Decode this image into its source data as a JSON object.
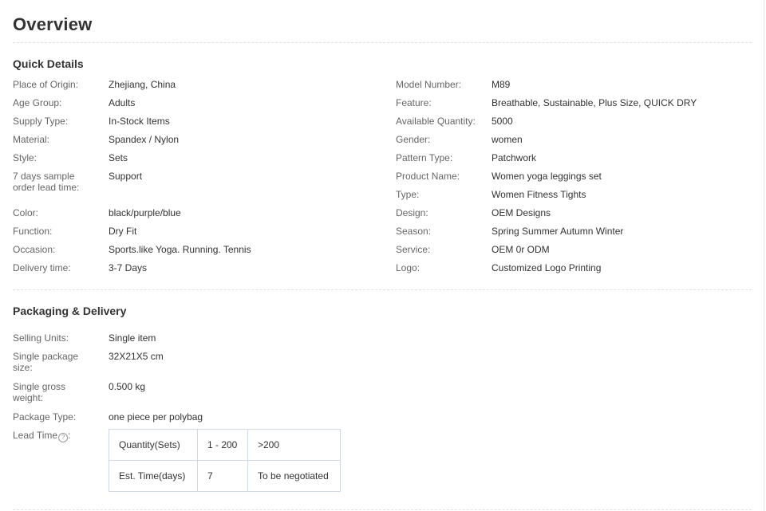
{
  "title": "Overview",
  "quick_details": {
    "heading": "Quick Details",
    "left": [
      {
        "label": "Place of Origin:",
        "value": "Zhejiang, China"
      },
      {
        "label": "Age Group:",
        "value": "Adults"
      },
      {
        "label": "Supply Type:",
        "value": "In-Stock Items"
      },
      {
        "label": "Material:",
        "value": "Spandex / Nylon"
      },
      {
        "label": "Style:",
        "value": "Sets"
      },
      {
        "label": "7 days sample order lead time:",
        "value": "Support"
      },
      {
        "label": "Color:",
        "value": "black/purple/blue"
      },
      {
        "label": "Function:",
        "value": "Dry Fit"
      },
      {
        "label": "Occasion:",
        "value": "Sports.like Yoga. Running. Tennis"
      },
      {
        "label": "Delivery time:",
        "value": "3-7 Days"
      }
    ],
    "right": [
      {
        "label": "Model Number:",
        "value": "M89"
      },
      {
        "label": "Feature:",
        "value": "Breathable, Sustainable, Plus Size, QUICK DRY"
      },
      {
        "label": "Available Quantity:",
        "value": "5000"
      },
      {
        "label": "Gender:",
        "value": "women"
      },
      {
        "label": "Pattern Type:",
        "value": "Patchwork"
      },
      {
        "label": "Product Name:",
        "value": "Women yoga leggings set"
      },
      {
        "label": "Type:",
        "value": "Women Fitness Tights"
      },
      {
        "label": "Design:",
        "value": "OEM Designs"
      },
      {
        "label": "Season:",
        "value": "Spring Summer Autumn Winter"
      },
      {
        "label": "Service:",
        "value": "OEM 0r ODM"
      },
      {
        "label": "Logo:",
        "value": "Customized Logo Printing"
      }
    ]
  },
  "packaging": {
    "heading": "Packaging & Delivery",
    "rows": [
      {
        "label": "Selling Units:",
        "value": "Single item"
      },
      {
        "label": "Single package size:",
        "value": "32X21X5 cm"
      },
      {
        "label": "Single gross weight:",
        "value": "0.500 kg"
      },
      {
        "label": "Package Type:",
        "value": "one piece per polybag"
      }
    ],
    "lead_time": {
      "label": "Lead Time",
      "help_icon": "question-circle-icon",
      "help_glyph": "?",
      "separator": ":",
      "table": [
        [
          "Quantity(Sets)",
          "1 - 200",
          ">200"
        ],
        [
          "Est. Time(days)",
          "7",
          "To be negotiated"
        ]
      ]
    }
  }
}
